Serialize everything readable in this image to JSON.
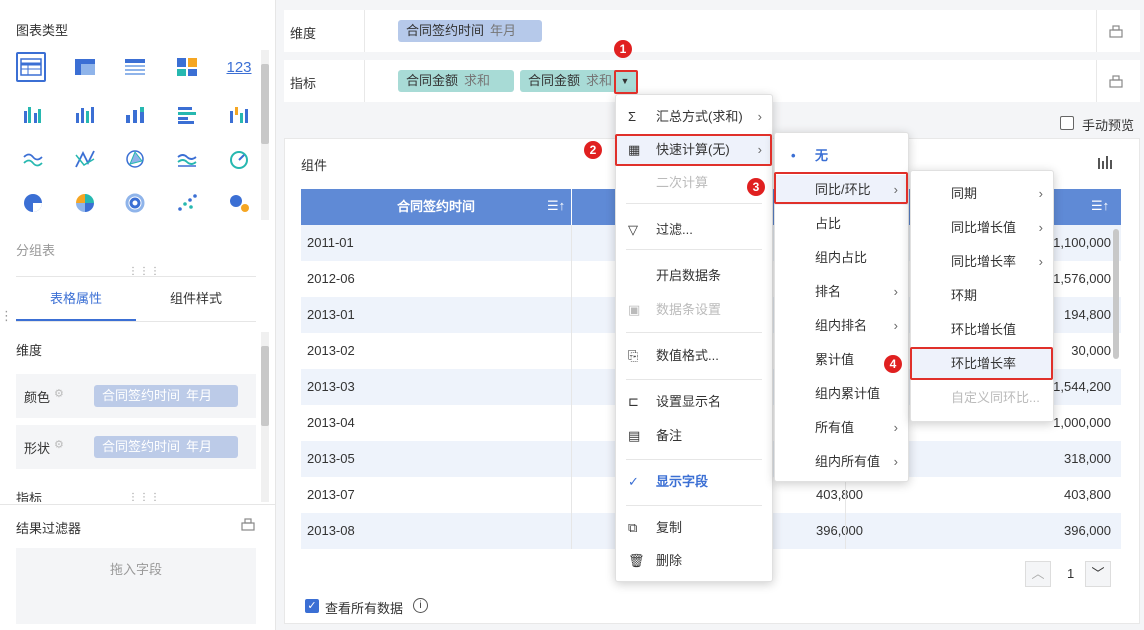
{
  "left": {
    "chart_type_title": "图表类型",
    "grouped_table_label": "分组表",
    "tabs": [
      {
        "label": "表格属性"
      },
      {
        "label": "组件样式"
      }
    ],
    "dimension_label": "维度",
    "color_label": "颜色",
    "shape_label": "形状",
    "color_field": {
      "name": "合同签约时间",
      "sub": "年月"
    },
    "shape_field": {
      "name": "合同签约时间",
      "sub": "年月"
    },
    "indicator_label": "指标",
    "result_filter_label": "结果过滤器",
    "drop_field": "拖入字段",
    "icon_123": "123"
  },
  "top": {
    "dimension_label": "维度",
    "indicator_label": "指标",
    "dim_pill": {
      "name": "合同签约时间",
      "sub": "年月"
    },
    "ind_pills": [
      {
        "name": "合同金额",
        "sub": "求和"
      },
      {
        "name": "合同金额",
        "sub": "求和"
      }
    ],
    "manual_preview": "手动预览"
  },
  "widget": {
    "title": "组件",
    "col1": "合同签约时间",
    "rows": [
      {
        "date": "2011-01",
        "v1": "",
        "v2": "1,100,000"
      },
      {
        "date": "2012-06",
        "v1": "",
        "v2": "1,576,000"
      },
      {
        "date": "2013-01",
        "v1": "",
        "v2": "194,800"
      },
      {
        "date": "2013-02",
        "v1": "",
        "v2": "30,000"
      },
      {
        "date": "2013-03",
        "v1": "",
        "v2": "1,544,200"
      },
      {
        "date": "2013-04",
        "v1": "",
        "v2": "1,000,000"
      },
      {
        "date": "2013-05",
        "v1": "",
        "v2": "318,000"
      },
      {
        "date": "2013-07",
        "v1": "403,800",
        "v2": "403,800"
      },
      {
        "date": "2013-08",
        "v1": "396,000",
        "v2": "396,000"
      }
    ],
    "page": "1",
    "view_all": "查看所有数据"
  },
  "menu1": {
    "items": [
      "汇总方式(求和)",
      "快速计算(无)",
      "二次计算",
      "过滤...",
      "开启数据条",
      "数据条设置",
      "数值格式...",
      "设置显示名",
      "备注",
      "显示字段",
      "复制",
      "删除"
    ]
  },
  "menu2": {
    "items": [
      "无",
      "同比/环比",
      "占比",
      "组内占比",
      "排名",
      "组内排名",
      "累计值",
      "组内累计值",
      "所有值",
      "组内所有值"
    ]
  },
  "menu3": {
    "items": [
      "同期",
      "同比增长值",
      "同比增长率",
      "环期",
      "环比增长值",
      "环比增长率",
      "自定义同环比..."
    ]
  },
  "badges": [
    "1",
    "2",
    "3",
    "4"
  ]
}
